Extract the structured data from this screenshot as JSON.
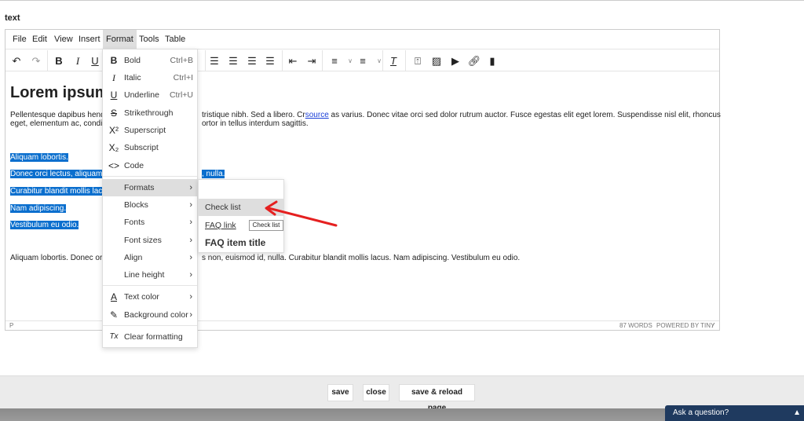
{
  "page_label": "text",
  "menubar": [
    "File",
    "Edit",
    "View",
    "Insert",
    "Format",
    "Tools",
    "Table"
  ],
  "toolbar_icons": [
    "undo-icon",
    "redo-icon",
    "bold-icon",
    "italic-icon",
    "underline-icon",
    "align-left-icon",
    "align-center-icon",
    "align-right-icon",
    "align-justify-icon",
    "outdent-icon",
    "indent-icon",
    "numbered-list-icon",
    "bullet-list-icon",
    "clear-formatting-icon",
    "upload-icon",
    "image-icon",
    "media-icon",
    "link-icon",
    "bookmark-icon"
  ],
  "content": {
    "heading": "Lorem ipsum",
    "p1_left_1": "Pellentesque dapibus hend",
    "p1_right_1a": "tristique nibh. Sed a libero. Cr",
    "p1_link": "source",
    "p1_right_1b": "  as varius. Donec vitae orci sed dolor rutrum auctor. Fusce egestas elit eget lorem. Suspendisse nisl elit, rhoncus",
    "p1_left_2": "eget, elementum ac, condir",
    "p1_right_2": "ortor in tellus interdum sagittis.",
    "selected": [
      "Aliquam lobortis.",
      "Donec orci lectus, aliquam",
      "Curabitur blandit mollis lacu",
      "Nam adipiscing.",
      "Vestibulum eu odio."
    ],
    "selected_tail": ", nulla.",
    "p2_left": "Aliquam lobortis. Donec orc",
    "p2_right": "s non, euismod id, nulla. Curabitur blandit mollis lacus. Nam adipiscing. Vestibulum eu odio."
  },
  "status": {
    "path": "P",
    "words": "87 WORDS",
    "powered": "POWERED BY TINY"
  },
  "format_menu": {
    "items": [
      {
        "label": "Bold",
        "shortcut": "Ctrl+B",
        "icon": "B"
      },
      {
        "label": "Italic",
        "shortcut": "Ctrl+I",
        "icon": "I"
      },
      {
        "label": "Underline",
        "shortcut": "Ctrl+U",
        "icon": "U"
      },
      {
        "label": "Strikethrough",
        "icon": "S"
      },
      {
        "label": "Superscript",
        "icon": "X²"
      },
      {
        "label": "Subscript",
        "icon": "X₂"
      },
      {
        "label": "Code",
        "icon": "<>"
      },
      {
        "label": "Formats"
      },
      {
        "label": "Blocks"
      },
      {
        "label": "Fonts"
      },
      {
        "label": "Font sizes"
      },
      {
        "label": "Align"
      },
      {
        "label": "Line height"
      },
      {
        "label": "Text color",
        "icon": "A"
      },
      {
        "label": "Background color",
        "icon": "✎"
      },
      {
        "label": "Clear formatting",
        "icon": "Tx"
      }
    ]
  },
  "formats_submenu": {
    "items": [
      "Check list",
      "FAQ link",
      "FAQ item title"
    ]
  },
  "tooltip": "Check list",
  "buttons": {
    "save": "save",
    "close": "close",
    "save_reload": "save & reload page"
  },
  "chat": {
    "label": "Ask a question?"
  },
  "colors": {
    "selection": "#0b6fce",
    "chat": "#1f3a5f",
    "arrow": "#e52020"
  }
}
